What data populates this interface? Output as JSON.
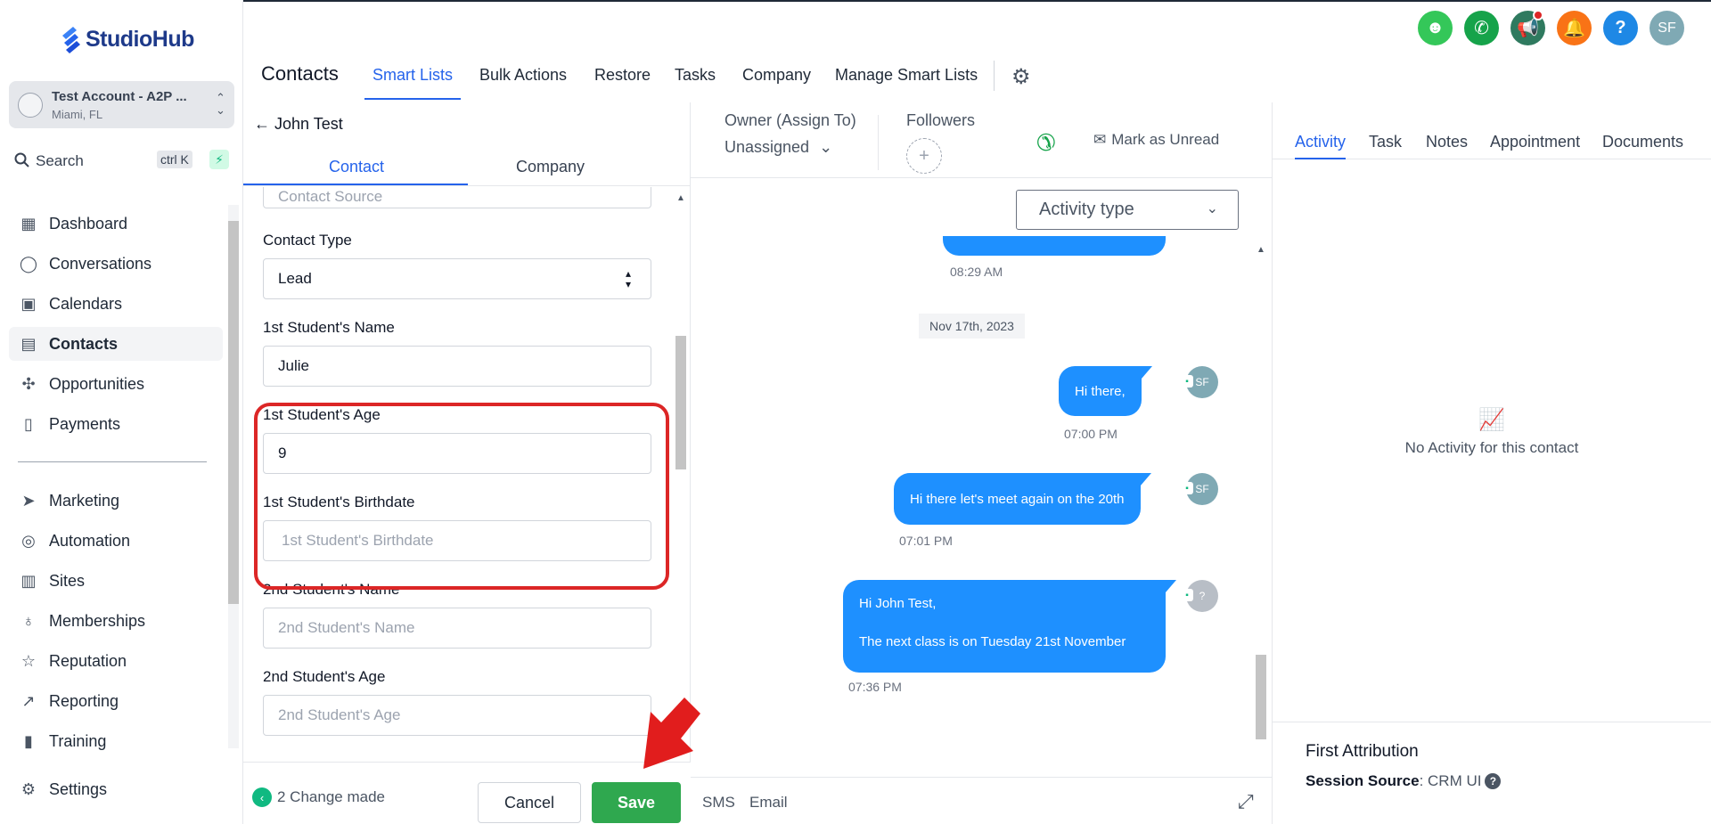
{
  "brand": {
    "name": "StudioHub"
  },
  "account": {
    "name": "Test Account - A2P ...",
    "location": "Miami, FL"
  },
  "search": {
    "label": "Search",
    "shortcut": "ctrl K"
  },
  "sidebar": {
    "items": [
      {
        "label": "Dashboard",
        "icon": "dashboard-icon"
      },
      {
        "label": "Conversations",
        "icon": "chat-bubble-icon"
      },
      {
        "label": "Calendars",
        "icon": "calendar-icon"
      },
      {
        "label": "Contacts",
        "icon": "contacts-book-icon",
        "active": true
      },
      {
        "label": "Opportunities",
        "icon": "opportunities-icon"
      },
      {
        "label": "Payments",
        "icon": "payments-icon"
      },
      {
        "label": "Marketing",
        "icon": "paper-plane-icon"
      },
      {
        "label": "Automation",
        "icon": "automation-icon"
      },
      {
        "label": "Sites",
        "icon": "sites-icon"
      },
      {
        "label": "Memberships",
        "icon": "memberships-icon"
      },
      {
        "label": "Reputation",
        "icon": "star-icon"
      },
      {
        "label": "Reporting",
        "icon": "trend-icon"
      },
      {
        "label": "Training",
        "icon": "book-icon"
      },
      {
        "label": "Settings",
        "icon": "gear-icon"
      }
    ]
  },
  "header": {
    "title": "Contacts",
    "tabs": [
      "Smart Lists",
      "Bulk Actions",
      "Restore",
      "Tasks",
      "Company",
      "Manage Smart Lists"
    ],
    "user_initials": "SF"
  },
  "contact": {
    "back_label": "John Test",
    "tabs": [
      "Contact",
      "Company"
    ],
    "partial_field_placeholder": "Contact Source",
    "fields": [
      {
        "label": "Contact Type",
        "value": "Lead"
      },
      {
        "label": "1st Student's Name",
        "value": "Julie"
      },
      {
        "label": "1st Student's Age",
        "value": "9"
      },
      {
        "label": "1st Student's Birthdate",
        "placeholder": "1st Student's Birthdate"
      },
      {
        "label": "2nd Student's Name",
        "placeholder": "2nd Student's Name"
      },
      {
        "label": "2nd Student's Age",
        "placeholder": "2nd Student's Age"
      }
    ],
    "changes_label": "2 Change made",
    "cancel_label": "Cancel",
    "save_label": "Save"
  },
  "conversation": {
    "owner_label": "Owner (Assign To)",
    "owner_value": "Unassigned",
    "followers_label": "Followers",
    "mark_unread_label": "Mark as Unread",
    "activity_type_placeholder": "Activity type",
    "messages": [
      {
        "time": "08:29 AM"
      },
      {
        "date_separator": "Nov 17th, 2023"
      },
      {
        "text": "Hi there,",
        "time": "07:00 PM",
        "sender": "SF"
      },
      {
        "text": "Hi there let's meet again on the 20th",
        "time": "07:01 PM",
        "sender": "SF"
      },
      {
        "line1": "Hi  John Test,",
        "line2": "The next class is on Tuesday 21st November",
        "time": "07:36 PM",
        "sender": "?"
      }
    ],
    "composer_tabs": [
      "SMS",
      "Email"
    ]
  },
  "activity": {
    "tabs": [
      "Activity",
      "Task",
      "Notes",
      "Appointment",
      "Documents"
    ],
    "empty_text": "No Activity for this contact",
    "attribution_title": "First Attribution",
    "session_source_label": "Session Source",
    "session_source_value": "CRM UI"
  },
  "colors": {
    "accent": "#2563eb",
    "save": "#2fa84f",
    "highlight": "#dc2626",
    "bubble": "#1e90ff"
  }
}
